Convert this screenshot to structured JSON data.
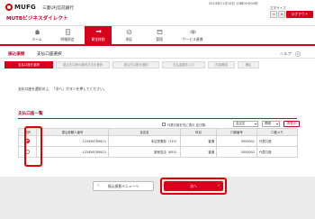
{
  "header": {
    "brand": "MUFG",
    "bank_name": "三菱UFJ信託銀行",
    "service_name": "MUTBビジネスダイレクト",
    "datetime": "2014年11月18日 10時00分00秒",
    "font_size_label": "文字サイズ",
    "font_small": "小",
    "font_large": "大",
    "logout": "ログアウト",
    "accent_color": "#d6001c"
  },
  "nav": {
    "items": [
      {
        "label": "ホーム",
        "icon": "home-icon"
      },
      {
        "label": "明細照会",
        "icon": "document-icon"
      },
      {
        "label": "資金移動",
        "icon": "transfer-icon",
        "active": true
      },
      {
        "label": "承認",
        "icon": "approval-icon"
      },
      {
        "label": "管理",
        "icon": "management-icon"
      },
      {
        "label": "サービス連携",
        "icon": "service-icon"
      }
    ]
  },
  "page": {
    "category": "振込振替",
    "title": "支払口座選択",
    "help": "ヘルプ"
  },
  "steps": [
    {
      "label": "支払口座を選択",
      "active": true
    },
    {
      "label": "振込先口座の選択方法を選択"
    },
    {
      "label": "振込先口座を選択"
    },
    {
      "label": "支払金額を入力"
    },
    {
      "label": "内容確認"
    },
    {
      "label": "確定"
    }
  ],
  "instruction": "支払口座を選択の上、「次へ」ボタンを押してください。",
  "section": {
    "title": "支払口座一覧"
  },
  "controls": {
    "checkbox_label": "代表口座を先に表示 並び順：",
    "sort_option": "支店名",
    "order_option": "昇順",
    "redisplay": "再表示"
  },
  "table": {
    "headers": [
      "選択",
      "振込依頼人番号",
      "支店名",
      "科目",
      "口座番号",
      "口座メモ"
    ],
    "rows": [
      {
        "selected": true,
        "requester": "1234567890(1)",
        "branch": "本店営業部（110）",
        "subject": "普通",
        "account": "5000001",
        "memo": "代表口座"
      },
      {
        "selected": false,
        "requester": "1234567890(2)",
        "branch": "新宿支店（650）",
        "subject": "普通",
        "account": "5000002",
        "memo": "代表口座"
      }
    ]
  },
  "buttons": {
    "back": "振込振替メニューへ",
    "next": "次へ"
  }
}
